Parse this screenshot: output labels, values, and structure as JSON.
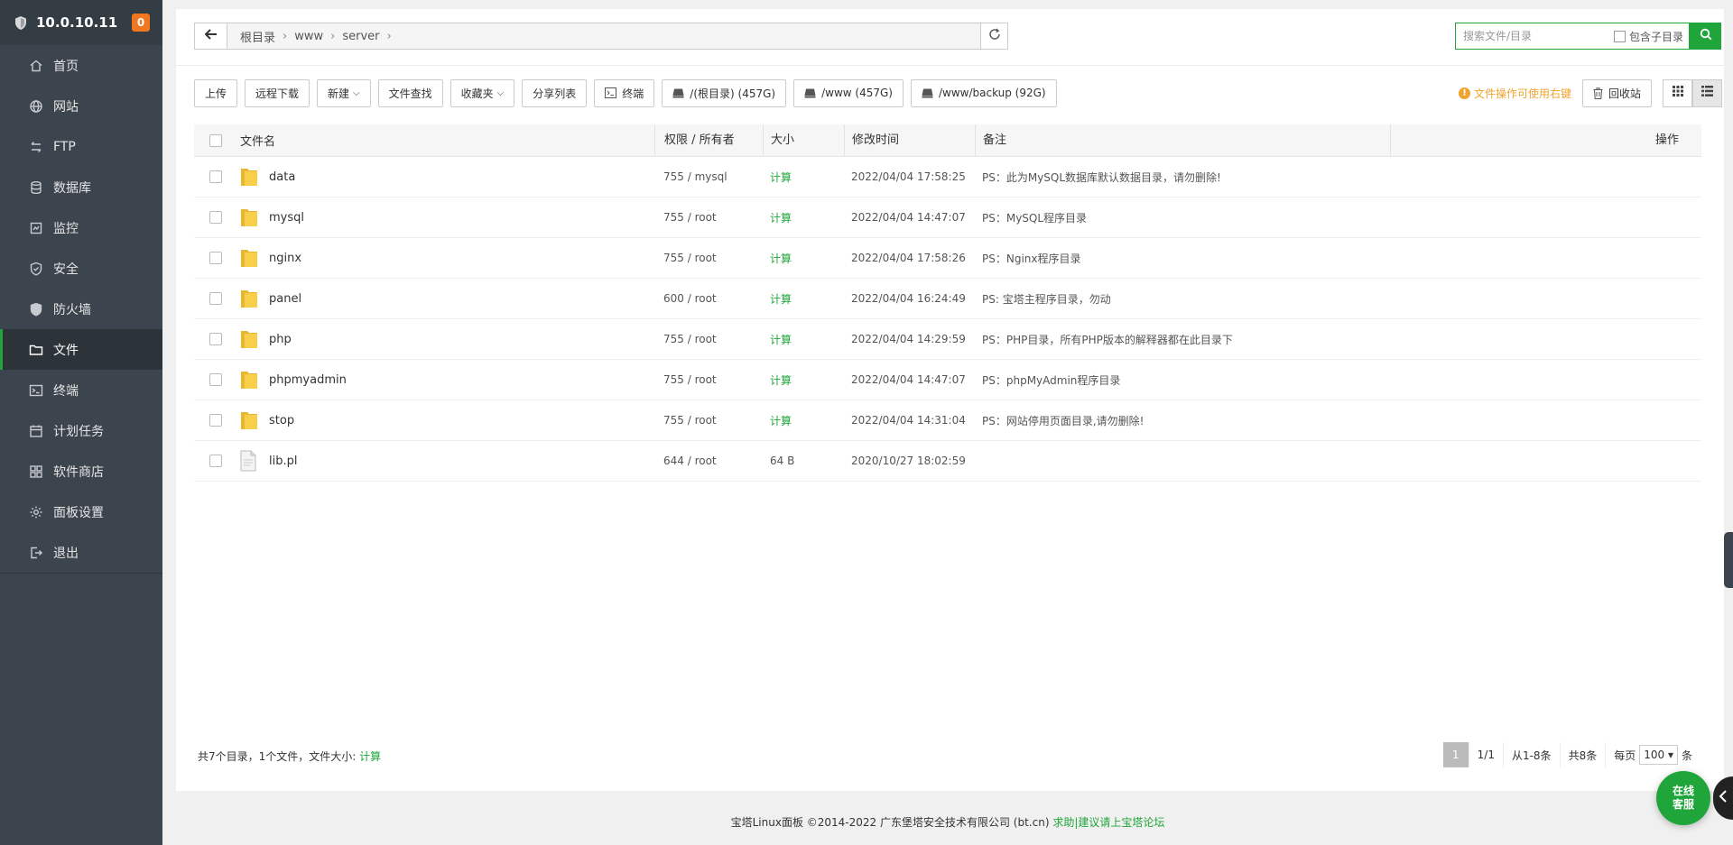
{
  "sidebar": {
    "host": "10.0.10.11",
    "badge": "0",
    "items": [
      {
        "label": "首页",
        "icon": "home-icon"
      },
      {
        "label": "网站",
        "icon": "globe-icon"
      },
      {
        "label": "FTP",
        "icon": "ftp-icon"
      },
      {
        "label": "数据库",
        "icon": "database-icon"
      },
      {
        "label": "监控",
        "icon": "monitor-icon"
      },
      {
        "label": "安全",
        "icon": "shield-check-icon"
      },
      {
        "label": "防火墙",
        "icon": "firewall-icon"
      },
      {
        "label": "文件",
        "icon": "folder-icon",
        "active": true
      },
      {
        "label": "终端",
        "icon": "terminal-icon"
      },
      {
        "label": "计划任务",
        "icon": "calendar-icon"
      },
      {
        "label": "软件商店",
        "icon": "apps-icon"
      },
      {
        "label": "面板设置",
        "icon": "settings-icon"
      },
      {
        "label": "退出",
        "icon": "logout-icon"
      }
    ]
  },
  "path": {
    "crumbs": [
      "根目录",
      "www",
      "server"
    ]
  },
  "search": {
    "placeholder": "搜索文件/目录",
    "include_sub_label": "包含子目录"
  },
  "toolbar": {
    "upload": "上传",
    "remote_download": "远程下载",
    "new": "新建",
    "find": "文件查找",
    "favorites": "收藏夹",
    "share_list": "分享列表",
    "terminal": "终端",
    "disks": [
      "/(根目录) (457G)",
      "/www (457G)",
      "/www/backup (92G)"
    ],
    "tip": "文件操作可使用右键",
    "recycle": "回收站"
  },
  "table": {
    "headers": {
      "name": "文件名",
      "perm": "权限 / 所有者",
      "size": "大小",
      "mtime": "修改时间",
      "note": "备注",
      "ops": "操作"
    },
    "rows": [
      {
        "name": "data",
        "type": "folder",
        "perm": "755 / mysql",
        "size": "计算",
        "mtime": "2022/04/04 17:58:25",
        "note": "PS：此为MySQL数据库默认数据目录，请勿删除!"
      },
      {
        "name": "mysql",
        "type": "folder",
        "perm": "755 / root",
        "size": "计算",
        "mtime": "2022/04/04 14:47:07",
        "note": "PS：MySQL程序目录"
      },
      {
        "name": "nginx",
        "type": "folder",
        "perm": "755 / root",
        "size": "计算",
        "mtime": "2022/04/04 17:58:26",
        "note": "PS：Nginx程序目录"
      },
      {
        "name": "panel",
        "type": "folder",
        "perm": "600 / root",
        "size": "计算",
        "mtime": "2022/04/04 16:24:49",
        "note": "PS: 宝塔主程序目录，勿动"
      },
      {
        "name": "php",
        "type": "folder",
        "perm": "755 / root",
        "size": "计算",
        "mtime": "2022/04/04 14:29:59",
        "note": "PS：PHP目录，所有PHP版本的解释器都在此目录下"
      },
      {
        "name": "phpmyadmin",
        "type": "folder",
        "perm": "755 / root",
        "size": "计算",
        "mtime": "2022/04/04 14:47:07",
        "note": "PS：phpMyAdmin程序目录"
      },
      {
        "name": "stop",
        "type": "folder",
        "perm": "755 / root",
        "size": "计算",
        "mtime": "2022/04/04 14:31:04",
        "note": "PS：网站停用页面目录,请勿删除!"
      },
      {
        "name": "lib.pl",
        "type": "file",
        "perm": "644 / root",
        "size": "64 B",
        "mtime": "2020/10/27 18:02:59",
        "note": ""
      }
    ]
  },
  "footer": {
    "summary": "共7个目录，1个文件，文件大小:",
    "calc": "计算",
    "page_current": "1",
    "page_total": "1/1",
    "range": "从1-8条",
    "count": "共8条",
    "per_page_label": "每页",
    "per_page_value": "100",
    "per_page_unit": "条"
  },
  "copyright": {
    "text": "宝塔Linux面板 ©2014-2022 广东堡塔安全技术有限公司 (bt.cn)",
    "link": "求助|建议请上宝塔论坛"
  },
  "online_service": {
    "line1": "在线",
    "line2": "客服"
  },
  "colors": {
    "accent": "#20a53a",
    "sidebar": "#3c444d",
    "badge": "#f0771f",
    "tip": "#f0a32d",
    "folder": "#f5c642"
  }
}
